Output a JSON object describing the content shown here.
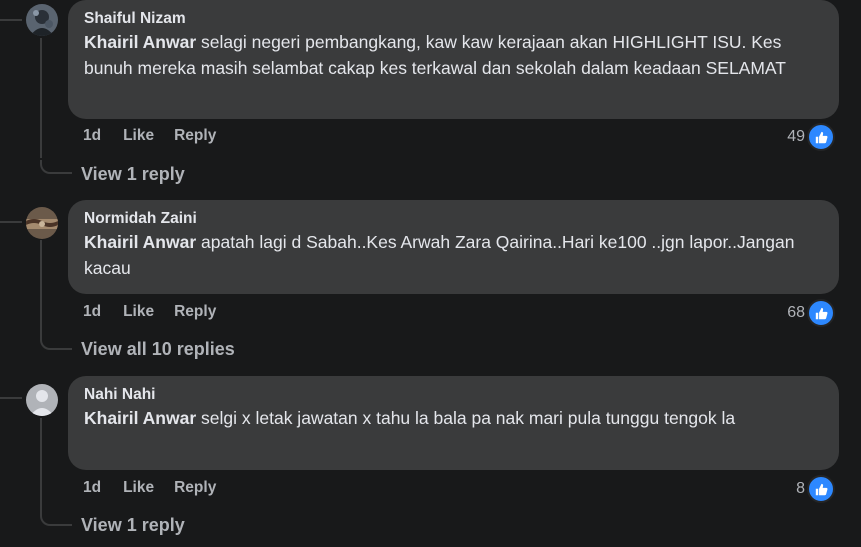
{
  "comments": [
    {
      "author": "Shaiful Nizam",
      "mention": "Khairil Anwar",
      "text": " selagi negeri pembangkang, kaw kaw kerajaan akan HIGHLIGHT ISU. Kes bunuh mereka masih selambat cakap kes terkawal dan sekolah dalam keadaan SELAMAT",
      "time": "1d",
      "like_label": "Like",
      "reply_label": "Reply",
      "reaction_count": "49",
      "view_replies": "View 1 reply"
    },
    {
      "author": "Normidah Zaini",
      "mention": "Khairil Anwar",
      "text": " apatah lagi d Sabah..Kes Arwah Zara Qairina..Hari ke100 ..jgn lapor..Jangan kacau",
      "time": "1d",
      "like_label": "Like",
      "reply_label": "Reply",
      "reaction_count": "68",
      "view_replies": "View all 10 replies"
    },
    {
      "author": "Nahi Nahi",
      "mention": "Khairil Anwar",
      "text": " selgi x letak jawatan x tahu la bala pa nak mari pula tunggu tengok la",
      "time": "1d",
      "like_label": "Like",
      "reply_label": "Reply",
      "reaction_count": "8",
      "view_replies": "View 1 reply"
    }
  ],
  "icons": {
    "reaction": "like-thumb-icon",
    "default_avatar": "person-silhouette-icon"
  },
  "colors": {
    "background": "#18191a",
    "bubble": "#3a3b3c",
    "secondary_text": "#b0b3b8",
    "like_blue": "#2d88ff"
  }
}
